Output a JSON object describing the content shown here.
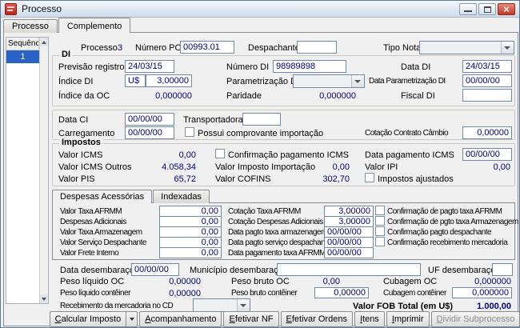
{
  "window": {
    "title": "Processo"
  },
  "tabs": {
    "processo": "Processo",
    "complemento": "Complemento"
  },
  "sidebar": {
    "header": "Sequência",
    "selected_row": "1"
  },
  "header": {
    "processo_label": "Processo",
    "processo_value": "3",
    "numero_po_label": "Número PO",
    "numero_po_value": "00993.01",
    "despachante_label": "Despachante",
    "despachante_value": "",
    "tipo_nota_label": "Tipo Nota",
    "tipo_nota_value": ""
  },
  "di": {
    "title": "DI",
    "previsao_registro_label": "Previsão registro",
    "previsao_registro_value": "24/03/15",
    "numero_di_label": "Número DI",
    "numero_di_value": "98989898",
    "data_di_label": "Data DI",
    "data_di_value": "24/03/15",
    "indice_di_label": "Índice DI",
    "indice_di_currency": "U$",
    "indice_di_value": "3,00000",
    "parametrizacao_di_label": "Parametrização DI",
    "parametrizacao_di_value": "",
    "data_parametrizacao_di_label": "Data Parametrização DI",
    "data_parametrizacao_di_value": "00/00/00",
    "indice_da_oc_label": "Índice da OC",
    "indice_da_oc_value": "0,000000",
    "paridade_label": "Paridade",
    "paridade_value": "0,000000",
    "fiscal_di_label": "Fiscal DI",
    "fiscal_di_value": ""
  },
  "ci": {
    "data_ci_label": "Data CI",
    "data_ci_value": "00/00/00",
    "transportadora_label": "Transportadora",
    "transportadora_value": "",
    "carregamento_label": "Carregamento",
    "carregamento_value": "00/00/00",
    "possui_comprovante_label": "Possui comprovante importação",
    "possui_comprovante_checked": false,
    "cotacao_contrato_cambio_label": "Cotação Contrato Câmbio",
    "cotacao_contrato_cambio_value": "0,00000"
  },
  "impostos": {
    "title": "Impostos",
    "valor_icms_label": "Valor ICMS",
    "valor_icms_value": "0,00",
    "confirmacao_pagamento_icms_label": "Confirmação pagamento ICMS",
    "confirmacao_pagamento_icms_checked": false,
    "data_pagamento_icms_label": "Data pagamento ICMS",
    "data_pagamento_icms_value": "00/00/00",
    "valor_icms_outros_label": "Valor ICMS Outros",
    "valor_icms_outros_value": "4.058,34",
    "valor_imposto_importacao_label": "Valor Imposto Importação",
    "valor_imposto_importacao_value": "0,00",
    "valor_ipi_label": "Valor IPI",
    "valor_ipi_value": "0,00",
    "valor_pis_label": "Valor PIS",
    "valor_pis_value": "65,72",
    "valor_cofins_label": "Valor COFINS",
    "valor_cofins_value": "302,70",
    "impostos_ajustados_label": "Impostos ajustados",
    "impostos_ajustados_checked": false
  },
  "despesas": {
    "tab_acessorias": "Despesas Acessórias",
    "tab_indexadas": "Indexadas",
    "valor_taxa_afrmm_label": "Valor Taxa AFRMM",
    "valor_taxa_afrmm_value": "0,00",
    "cotacao_taxa_afrmm_label": "Cotação Taxa AFRMM",
    "cotacao_taxa_afrmm_value": "3,00000",
    "conf_pagto_taxa_afrmm_label": "Confirmação de pagto taxa AFRMM",
    "conf_pagto_taxa_afrmm_checked": false,
    "despesas_adicionais_label": "Despesas Adicionais",
    "despesas_adicionais_value": "0,00",
    "cotacao_despesas_adicionais_label": "Cotação Despesas Adicionais",
    "cotacao_despesas_adicionais_value": "3,00000",
    "conf_pgto_taxa_armazenagem_label": "Confirmação de pgto taxa Armazenagem",
    "conf_pgto_taxa_armazenagem_checked": false,
    "valor_taxa_armazenagem_label": "Valor Taxa Armazenagem",
    "valor_taxa_armazenagem_value": "0,00",
    "data_pagto_taxa_armazenagem_label": "Data pagto taxa armazenagem",
    "data_pagto_taxa_armazenagem_value": "00/00/00",
    "conf_pagto_despachante_label": "Confirmação pagto despachante",
    "conf_pagto_despachante_checked": false,
    "valor_servico_despachante_label": "Valor Serviço Despachante",
    "valor_servico_despachante_value": "0,00",
    "data_pagto_servico_despachante_label": "Data pagto serviço despachante",
    "data_pagto_servico_despachante_value": "00/00/00",
    "conf_recebimento_mercadoria_label": "Confirmação recebimento mercadoria",
    "conf_recebimento_mercadoria_checked": false,
    "valor_frete_interno_label": "Valor Frete Interno",
    "valor_frete_interno_value": "0,00",
    "data_pagamento_taxa_afrmm_label": "Data pagamento taxa AFRMM",
    "data_pagamento_taxa_afrmm_value": "00/00/00"
  },
  "desembaraco": {
    "data_label": "Data desembaraço",
    "data_value": "00/00/00",
    "municipio_label": "Município desembaraço",
    "municipio_value": "",
    "uf_label": "UF desembaraço",
    "uf_value": ""
  },
  "pesos": {
    "peso_liquido_oc_label": "Peso líquido OC",
    "peso_liquido_oc_value": "0,00000",
    "peso_bruto_oc_label": "Peso bruto OC",
    "peso_bruto_oc_value": "0,00",
    "cubagem_oc_label": "Cubagem OC",
    "cubagem_oc_value": "0,000000",
    "peso_liquido_conteiner_label": "Peso líquido contêiner",
    "peso_liquido_conteiner_value": "0,00000",
    "peso_bruto_conteiner_label": "Peso bruto contêiner",
    "peso_bruto_conteiner_value": "0,00000",
    "cubagem_conteiner_label": "Cubagem contêiner",
    "cubagem_conteiner_value": "0,000000"
  },
  "rodape": {
    "recebimento_label": "Recebimento da mercadoria no CD",
    "recebimento_value": "",
    "valor_fob_label": "Valor FOB Total (em U$)",
    "valor_fob_value": "1.000,00"
  },
  "buttons": {
    "calcular_imposto": "Calcular Imposto",
    "acompanhamento": "Acompanhamento",
    "efetivar_nf": "Efetivar NF",
    "efetivar_ordens": "Efetivar Ordens",
    "itens": "Itens",
    "imprimir": "Imprimir",
    "dividir_subprocesso": "Dividir Subprocesso"
  },
  "colors": {
    "value_text": "#000080",
    "selection": "#2a63c8",
    "close_button": "#c0392b"
  }
}
